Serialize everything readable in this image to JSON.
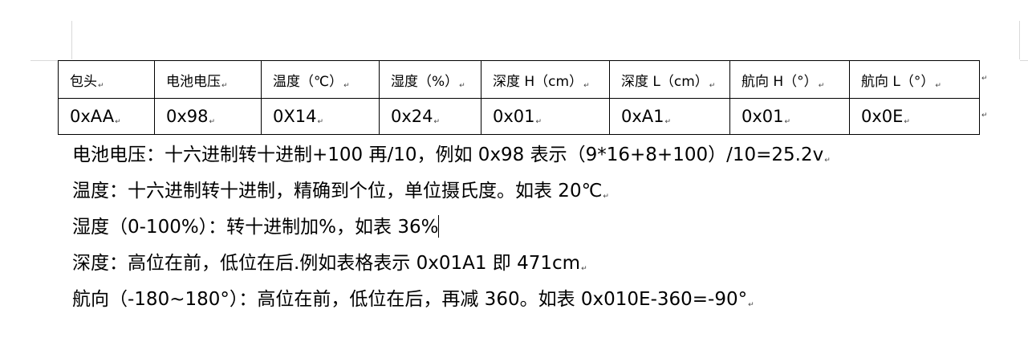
{
  "table": {
    "headers": [
      "包头",
      "电池电压",
      "温度（℃）",
      "湿度（%）",
      "深度 H（cm）",
      "深度 L（cm）",
      "航向 H（°）",
      "航向 L（°）"
    ],
    "values": [
      "0xAA",
      "0x98",
      "0X14",
      "0x24",
      "0x01",
      "0xA1",
      "0x01",
      "0x0E"
    ]
  },
  "notes": [
    "电池电压：十六进制转十进制+100 再/10，例如 0x98 表示（9*16+8+100）/10=25.2v",
    "温度：十六进制转十进制，精确到个位，单位摄氏度。如表 20℃",
    "湿度（0-100%）：转十进制加%，如表 36%",
    "深度：高位在前，低位在后.例如表格表示 0x01A1 即 471cm",
    "航向（-180~180°）：高位在前，低位在后，再减 360。如表 0x010E-360=-90°"
  ],
  "paragraph_mark": "↵"
}
